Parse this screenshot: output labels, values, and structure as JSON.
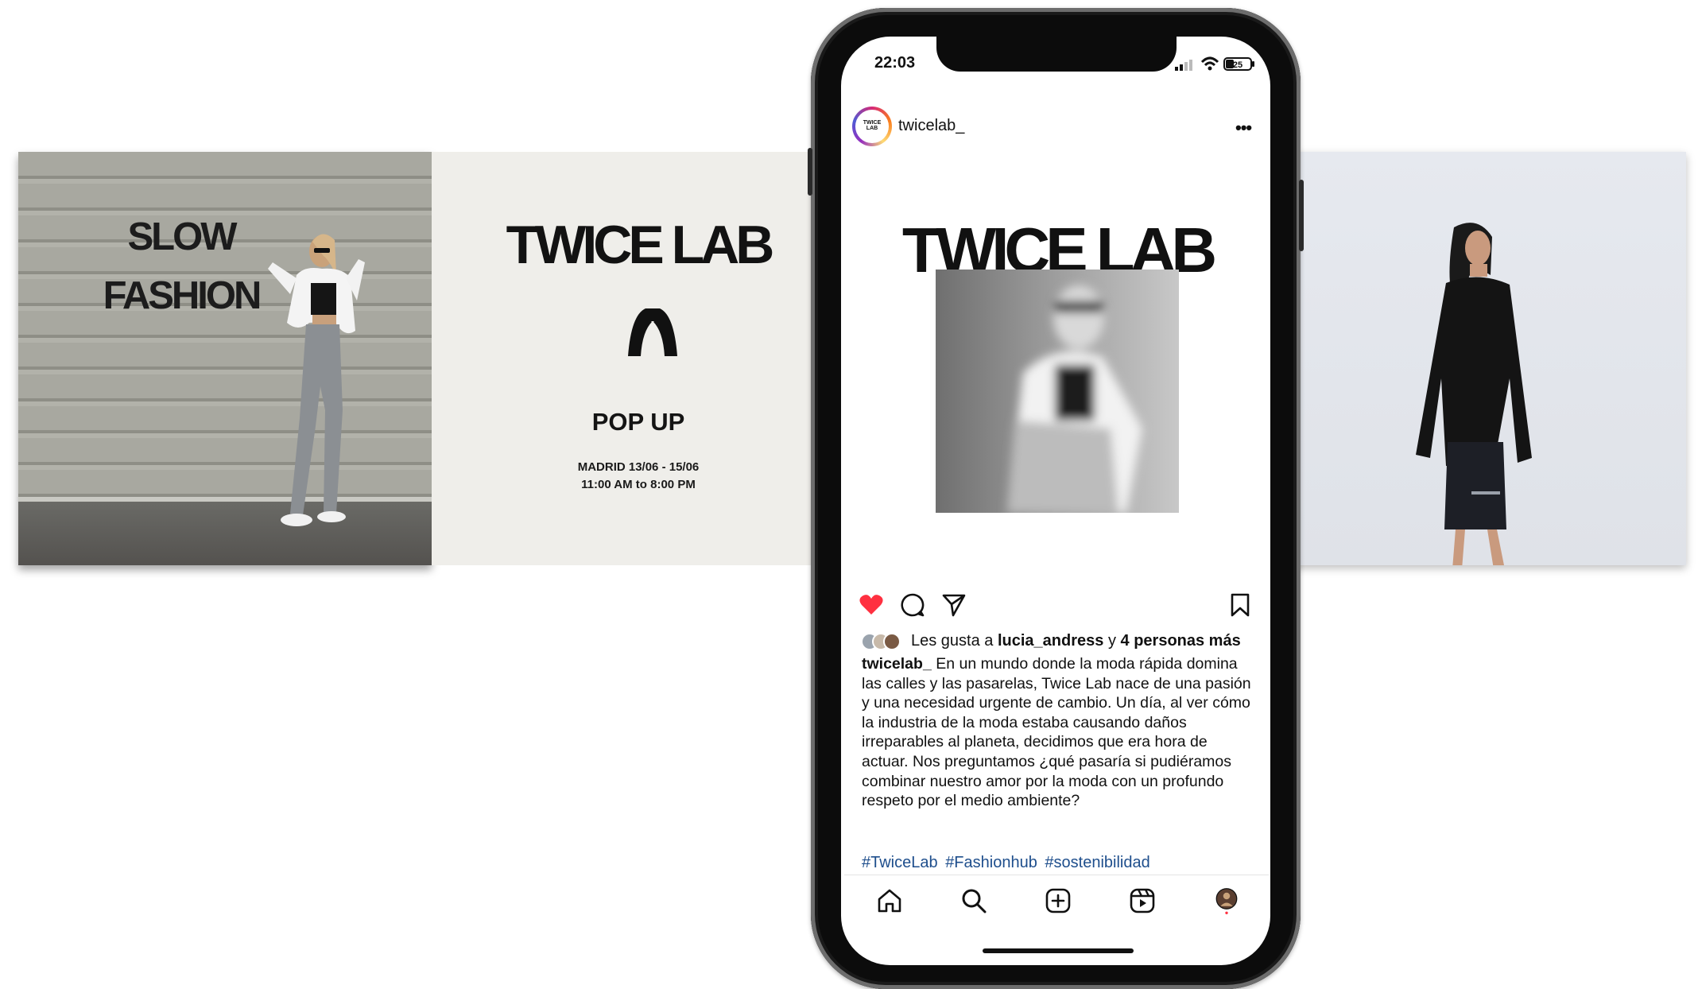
{
  "carousel": {
    "slide1": {
      "title_line1": "SLOW",
      "title_line2": "FASHION"
    },
    "slide2": {
      "brand": "TWICE LAB",
      "event_title": "POP UP",
      "date_line": "MADRID 13/06 - 15/06",
      "time_line": "11:00 AM to 8:00 PM"
    }
  },
  "phone": {
    "status_bar": {
      "time": "22:03",
      "battery": "25"
    },
    "post": {
      "avatar_text": "TWICE LAB",
      "username": "twicelab_",
      "more_icon": "more-options-icon",
      "image_brand": "TWICE LAB",
      "likes": {
        "prefix": "Les gusta a ",
        "user": "lucia_andress",
        "middle": " y ",
        "others": "4 personas más"
      },
      "caption": {
        "user": "twicelab_",
        "text": " En un mundo donde la moda rápida domina las calles y las pasarelas, Twice Lab nace de una pasión y una necesidad urgente de cambio. Un día, al ver cómo la industria de la moda estaba causando daños irreparables al planeta, decidimos que era hora de actuar. Nos preguntamos ¿qué pasaría si pudiéramos combinar nuestro amor por la moda con un profundo respeto por el medio ambiente?"
      },
      "hashtags": [
        "#TwiceLab",
        "#Fashionhub",
        "#sostenibilidad"
      ],
      "actions": [
        "heart-icon",
        "comment-icon",
        "share-icon",
        "bookmark-icon"
      ]
    },
    "nav": [
      "home-icon",
      "search-icon",
      "new-post-icon",
      "reels-icon",
      "profile-avatar"
    ]
  },
  "colors": {
    "like_red": "#ff3040",
    "hashtag_blue": "#1e4e8c",
    "panel_bg": "#efeeea"
  }
}
